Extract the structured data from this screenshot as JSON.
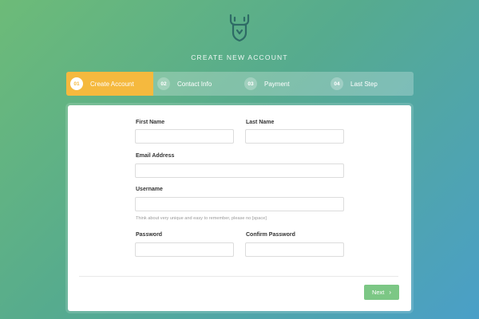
{
  "header": {
    "title": "CREATE NEW ACCOUNT",
    "logo_icon": "deer-antler-icon"
  },
  "steps": [
    {
      "number": "01",
      "label": "Create Account",
      "active": true
    },
    {
      "number": "02",
      "label": "Contact Info",
      "active": false
    },
    {
      "number": "03",
      "label": "Payment",
      "active": false
    },
    {
      "number": "04",
      "label": "Last Step",
      "active": false
    }
  ],
  "form": {
    "first_name": {
      "label": "First Name",
      "value": ""
    },
    "last_name": {
      "label": "Last Name",
      "value": ""
    },
    "email": {
      "label": "Email Address",
      "value": ""
    },
    "username": {
      "label": "Username",
      "value": "",
      "hint": "Think about very unique and easy to remember, please no [space]"
    },
    "password": {
      "label": "Password",
      "value": ""
    },
    "confirm_password": {
      "label": "Confirm Password",
      "value": ""
    }
  },
  "actions": {
    "next_label": "Next",
    "next_icon": "chevron-right-icon"
  },
  "colors": {
    "accent": "#f5b93e",
    "button": "#7cc785",
    "gradient_start": "#6dbb78",
    "gradient_end": "#4a9fc8"
  }
}
